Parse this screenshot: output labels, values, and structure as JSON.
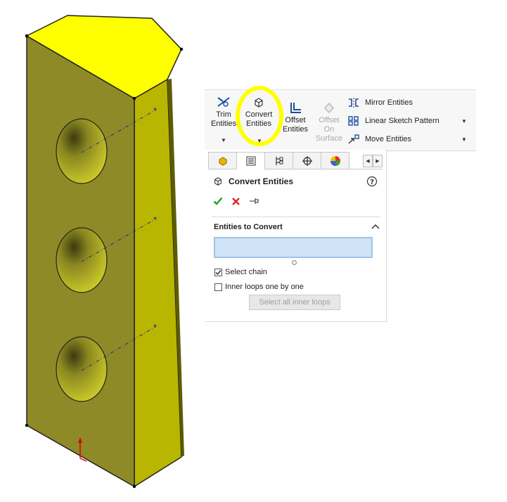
{
  "ribbon": {
    "trim_label": "Trim\nEntities",
    "convert_label": "Convert\nEntities",
    "offset_label": "Offset\nEntities",
    "offset_surface_label": "Offset\nOn\nSurface",
    "mirror_label": "Mirror Entities",
    "linear_pattern_label": "Linear Sketch Pattern",
    "move_label": "Move Entities",
    "highlight_color": "#ffff00"
  },
  "property_manager": {
    "tabs": [
      "feature-manager-icon",
      "property-manager-icon",
      "configuration-manager-icon",
      "dimxpert-icon",
      "display-manager-icon"
    ],
    "title": "Convert Entities",
    "ok_icon": "checkmark-icon",
    "cancel_icon": "x-icon",
    "pin_icon": "pushpin-icon",
    "group_title": "Entities to Convert",
    "entities_value": "",
    "select_chain_label": "Select chain",
    "select_chain_checked": true,
    "inner_loops_label": "Inner loops one by one",
    "inner_loops_checked": false,
    "select_all_inner_label": "Select all inner loops"
  },
  "model": {
    "body_color": "#c8c000",
    "top_color": "#ffff00",
    "hole_count": 3
  }
}
